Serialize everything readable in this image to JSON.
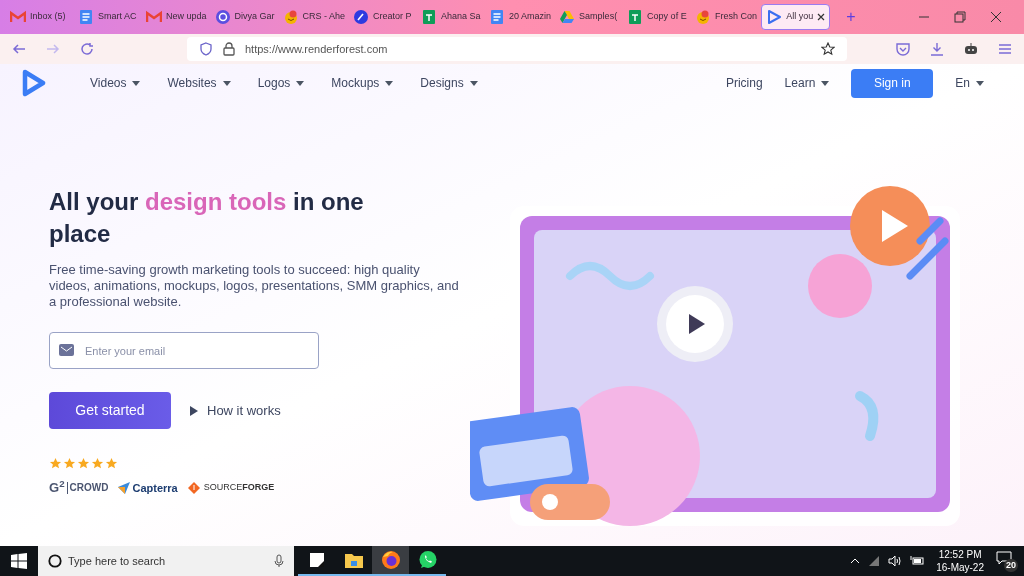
{
  "browser": {
    "tabs": [
      {
        "kind": "mail",
        "title": "Inbox (5)",
        "selected": false
      },
      {
        "kind": "doc",
        "title": "Smart AC",
        "selected": false
      },
      {
        "kind": "mail",
        "title": "New upda",
        "selected": false
      },
      {
        "kind": "chat",
        "title": "Divya Gar",
        "selected": false
      },
      {
        "kind": "face",
        "title": "CRS - Ahe",
        "selected": false
      },
      {
        "kind": "pen",
        "title": "Creator P",
        "selected": false
      },
      {
        "kind": "sheet",
        "title": "Ahana Sa",
        "selected": false
      },
      {
        "kind": "doc",
        "title": "20 Amazin",
        "selected": false
      },
      {
        "kind": "drive",
        "title": "Samples(",
        "selected": false
      },
      {
        "kind": "sheet",
        "title": "Copy of E",
        "selected": false
      },
      {
        "kind": "face",
        "title": "Fresh Con",
        "selected": false
      },
      {
        "kind": "play",
        "title": "All you",
        "selected": true
      }
    ],
    "new_tab": "+",
    "url": "https://www.renderforest.com"
  },
  "nav": {
    "items": [
      {
        "label": "Videos",
        "dropdown": true
      },
      {
        "label": "Websites",
        "dropdown": true
      },
      {
        "label": "Logos",
        "dropdown": true
      },
      {
        "label": "Mockups",
        "dropdown": true
      },
      {
        "label": "Designs",
        "dropdown": true
      }
    ],
    "right_items": [
      {
        "label": "Pricing",
        "dropdown": false
      },
      {
        "label": "Learn",
        "dropdown": true
      }
    ],
    "sign_in": "Sign in",
    "language": "En"
  },
  "hero": {
    "heading": [
      {
        "text": "All your ",
        "highlight": false
      },
      {
        "text": "design tools",
        "highlight": true
      },
      {
        "text": " in one place",
        "highlight": false
      }
    ],
    "description": "Free time-saving growth marketing tools to succeed: high quality videos, animations, mockups, logos, presentations, SMM graphics, and a professional website.",
    "email_placeholder": "Enter your email",
    "cta": "Get started",
    "secondary": "How it works",
    "stars": 5,
    "reviews": [
      {
        "kind": "g2",
        "mark": "G$^{2}$",
        "name": "CROWD"
      },
      {
        "kind": "capterra",
        "name": "Capterra"
      },
      {
        "kind": "sourceforge",
        "name": "SOURCE**FORGE**"
      }
    ]
  },
  "taskbar": {
    "search_placeholder": "Type here to search",
    "apps": [
      {
        "kind": "taskview",
        "selected": false
      },
      {
        "kind": "folder",
        "selected": false
      },
      {
        "kind": "firefox",
        "selected": true
      },
      {
        "kind": "whatsapp",
        "selected": false
      }
    ],
    "time": "12:52 PM",
    "date": "16-May-22",
    "notifications": "20"
  }
}
